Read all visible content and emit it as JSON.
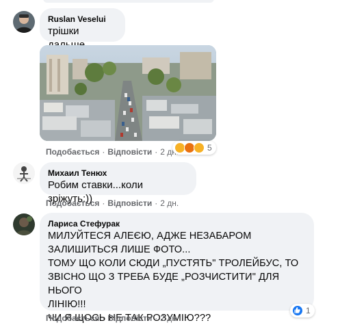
{
  "comments": [
    {
      "author": "Ruslan Veselui",
      "text": "трішки дальше",
      "like_label": "Подобається",
      "reply_label": "Відповісти",
      "time": "2 дн.",
      "reaction_count": "5",
      "reactions": [
        "sad-icon",
        "angry-icon",
        "haha-icon"
      ]
    },
    {
      "author": "Михаил Тенюх",
      "text": "Робим ставки...коли зріжуть:))",
      "like_label": "Подобається",
      "reply_label": "Відповісти",
      "time": "2 дн."
    },
    {
      "author": "Лариса Стефурак",
      "lines": [
        "МИЛУЙТЕСЯ АЛЕЄЮ, АДЖЕ НЕЗАБАРОМ",
        "ЗАЛИШИТЬСЯ ЛИШЕ ФОТО...",
        "ТОМУ ЩО КОЛИ СЮДИ „ПУСТЯТЬ\" ТРОЛЕЙБУС, ТО",
        "ЗВІСНО ЩО З ТРЕБА БУДЕ „РОЗЧИСТИТИ\" ДЛЯ НЬОГО",
        "ЛІНІЮ!!!",
        "ЧИ Я ЩОСЬ НЕ ТАК РОЗУМІЮ???"
      ],
      "like_label": "Подобається",
      "reply_label": "Відповісти",
      "time": "2 дн.",
      "reaction_count": "1",
      "reactions": [
        "like-icon"
      ]
    }
  ],
  "colors": {
    "bubble": "#f0f2f5",
    "meta": "#65676b",
    "like": "#1877f2",
    "angry": "#e9710f",
    "sad_haha": "#f7b125"
  }
}
